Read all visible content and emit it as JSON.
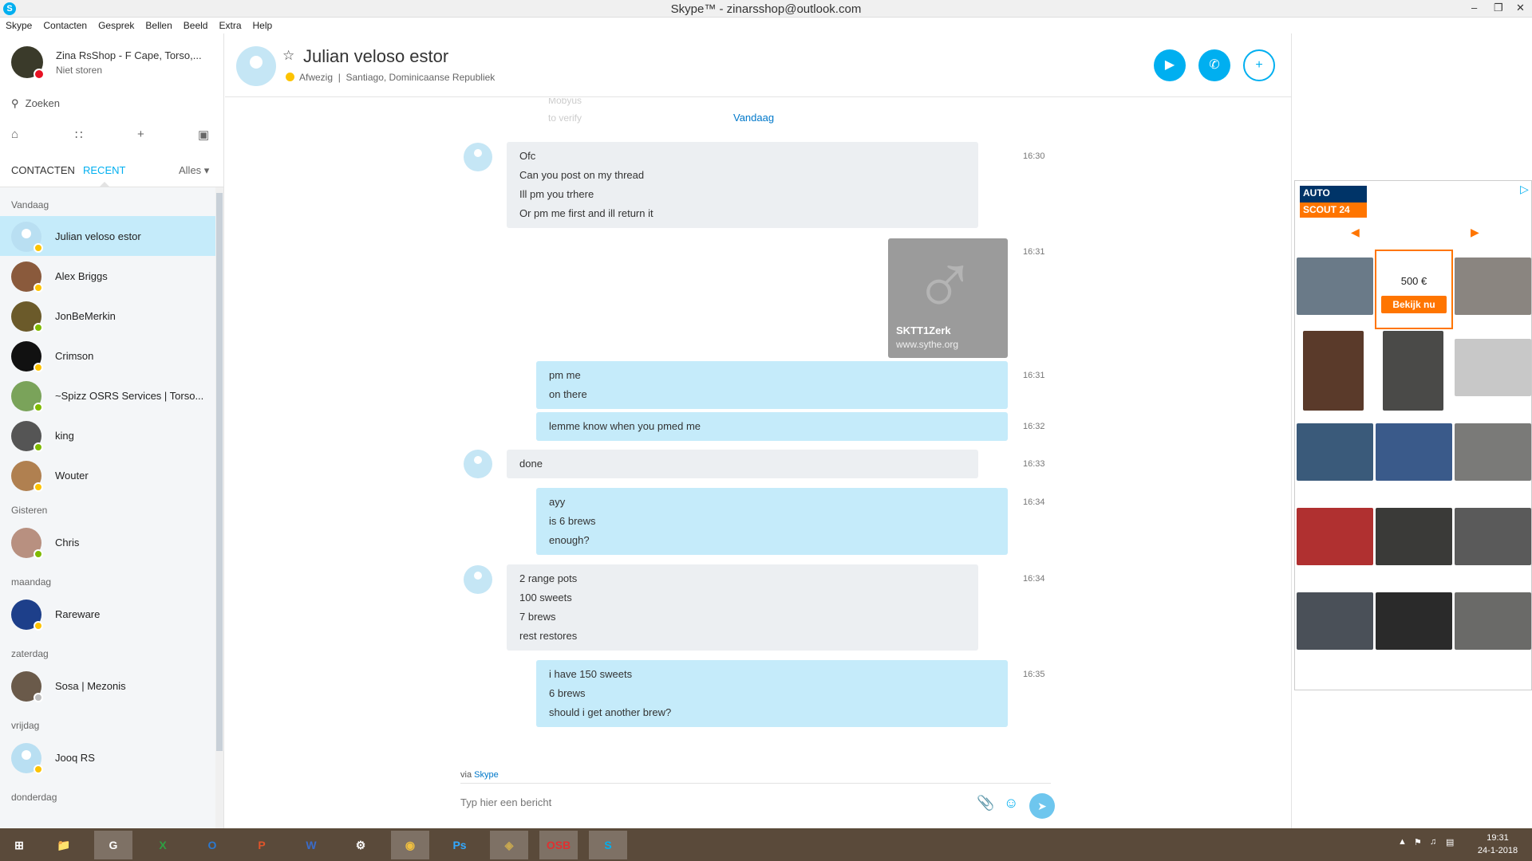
{
  "window": {
    "title": "Skype™ - zinarsshop@outlook.com",
    "logo": "S",
    "minimize": "–",
    "restore": "❐",
    "close": "✕"
  },
  "menu": [
    "Skype",
    "Contacten",
    "Gesprek",
    "Bellen",
    "Beeld",
    "Extra",
    "Help"
  ],
  "me": {
    "name": "Zina RsShop - F Cape, Torso,...",
    "status": "Niet storen"
  },
  "search": {
    "label": "Zoeken",
    "icon": "search-icon"
  },
  "tabs": {
    "contacts": "CONTACTEN",
    "recent": "RECENT",
    "filter": "Alles ▾"
  },
  "groups": [
    "Vandaag",
    "Gisteren",
    "maandag",
    "zaterdag",
    "vrijdag",
    "donderdag"
  ],
  "contacts": [
    {
      "name": "Julian veloso estor",
      "status": "away"
    },
    {
      "name": "Alex Briggs",
      "status": "away"
    },
    {
      "name": "JonBeMerkin",
      "status": "online"
    },
    {
      "name": "Crimson",
      "status": "away"
    },
    {
      "name": "~Spizz OSRS Services | Torso...",
      "status": "online"
    },
    {
      "name": "king",
      "status": "online"
    },
    {
      "name": "Wouter",
      "status": "away"
    },
    {
      "name": "Chris",
      "status": "online"
    },
    {
      "name": "Rareware",
      "status": "away"
    },
    {
      "name": "Sosa | Mezonis",
      "status": "offline"
    },
    {
      "name": "Jooq RS",
      "status": "away"
    }
  ],
  "header": {
    "name": "Julian veloso estor",
    "status": "Afwezig",
    "location": "Santiago, Dominicaanse Republiek",
    "separator": "|"
  },
  "chat": {
    "faded": [
      "Mobyus",
      "to verify"
    ],
    "today": "Vandaag",
    "messages": [
      {
        "dir": "in",
        "time": "16:30",
        "lines": [
          "Ofc",
          "Can you post on my thread",
          "Ill pm you trhere",
          "Or pm me first and ill return it"
        ]
      },
      {
        "dir": "out",
        "time": "16:31",
        "lines": [
          "pm me",
          "on there"
        ]
      },
      {
        "dir": "out",
        "time": "16:32",
        "lines": [
          "lemme know when you pmed me"
        ]
      },
      {
        "dir": "in",
        "time": "16:33",
        "lines": [
          "done"
        ]
      },
      {
        "dir": "out",
        "time": "16:34",
        "lines": [
          "ayy",
          "is 6 brews",
          "enough?"
        ]
      },
      {
        "dir": "in",
        "time": "16:34",
        "lines": [
          "2 range pots",
          "100 sweets",
          "7 brews",
          "rest restores"
        ]
      },
      {
        "dir": "out",
        "time": "16:35",
        "lines": [
          "i have 150 sweets",
          "6 brews",
          "should i get another brew?"
        ]
      }
    ],
    "image_card": {
      "time": "16:31",
      "caption": "SKTT1Zerk",
      "url": "www.sythe.org"
    }
  },
  "composer": {
    "via_prefix": "via",
    "via_service": "Skype",
    "placeholder": "Typ hier een bericht"
  },
  "ad": {
    "brand_line1": "AUTO",
    "brand_line2": "SCOUT 24",
    "price": "500 €",
    "cta": "Bekijk nu"
  },
  "taskbar": {
    "apps": [
      "Start",
      "Explorer",
      "G",
      "X",
      "O",
      "P",
      "W",
      "Steam",
      "Chrome",
      "Ps",
      "LoL",
      "OSB",
      "S"
    ],
    "time": "19:31",
    "date": "24-1-2018"
  },
  "colors": {
    "accent": "#00aff0",
    "away": "#fdc300",
    "online": "#7fba00",
    "dnd": "#e81123",
    "ad_orange": "#ff7500"
  }
}
